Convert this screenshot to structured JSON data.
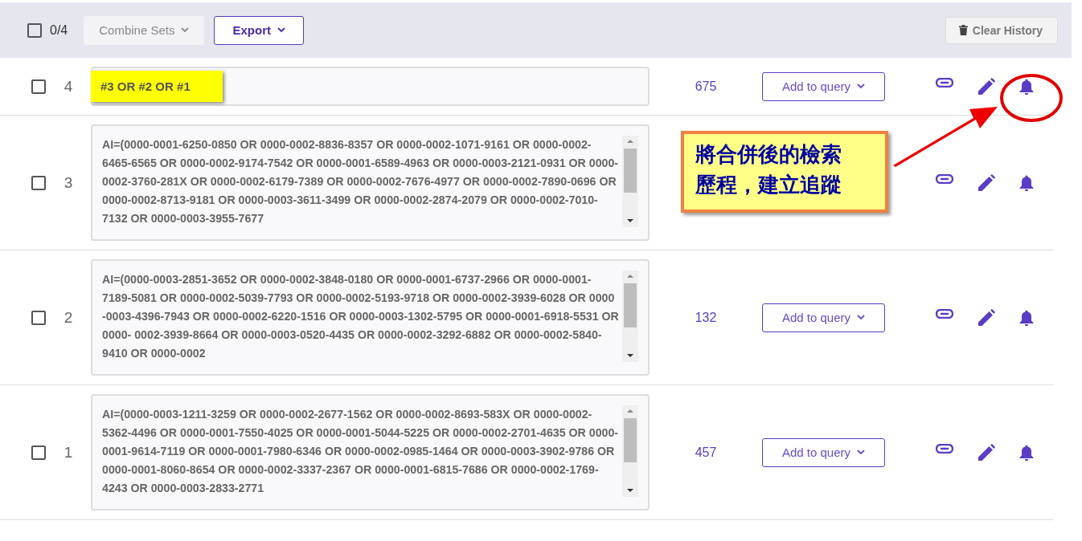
{
  "toolbar": {
    "select_all": {
      "checked": false
    },
    "selection_count": "0/4",
    "buttons": [
      {
        "label": "Combine Sets",
        "disabled": true
      },
      {
        "label": "Export",
        "disabled": false
      }
    ],
    "clear_history": "Clear History"
  },
  "history": [
    {
      "number": "4",
      "checked": false,
      "kind": "combined",
      "query": "#3 OR #2 OR #1",
      "count": "675",
      "add_button": "Add to query"
    },
    {
      "number": "3",
      "checked": false,
      "kind": "long",
      "query": "AI=(0000-0001-6250-0850 OR 0000-0002-8836-8357 OR 0000-0002-1071-9161 OR 0000-0002-6465-6565 OR 0000-0002-9174-7542 OR 0000-0001-6589-4963 OR 0000-0003-2121-0931 OR 0000-0002-3760-281X OR 0000-0002-6179-7389 OR 0000-0002-7676-4977 OR 0000-0002-7890-0696 OR 0000-0002-8713-9181 OR 0000-0003-3611-3499 OR 0000-0002-2874-2079 OR 0000-0002-7010-7132 OR 0000-0003-3955-7677"
    },
    {
      "number": "2",
      "checked": false,
      "kind": "long",
      "query": "AI=(0000-0003-2851-3652 OR 0000-0002-3848-0180 OR 0000-0001-6737-2966 OR 0000-0001-7189-5081 OR 0000-0002-5039-7793 OR 0000-0002-5193-9718 OR 0000-0002-3939-6028 OR 0000 -0003-4396-7943 OR 0000-0002-6220-1516 OR 0000-0003-1302-5795 OR 0000-0001-6918-5531 OR 0000- 0002-3939-8664 OR 0000-0003-0520-4435 OR 0000-0002-3292-6882 OR 0000-0002-5840-9410 OR 0000-0002",
      "count": "132",
      "add_button": "Add to query"
    },
    {
      "number": "1",
      "checked": false,
      "kind": "long",
      "query": "AI=(0000-0003-1211-3259 OR 0000-0002-2677-1562 OR 0000-0002-8693-583X OR 0000-0002-5362-4496 OR 0000-0001-7550-4025 OR 0000-0001-5044-5225 OR 0000-0002-2701-4635 OR 0000-0001-9614-7119 OR 0000-0001-7980-6346 OR 0000-0002-0985-1464 OR 0000-0003-3902-9786 OR 0000-0001-8060-8654 OR 0000-0002-3337-2367 OR 0000-0001-6815-7686 OR 0000-0002-1769-4243 OR 0000-0003-2833-2771",
      "count": "457",
      "add_button": "Add to query"
    }
  ],
  "annotation": {
    "text": "將合併後的檢索歷程，建立追蹤"
  }
}
